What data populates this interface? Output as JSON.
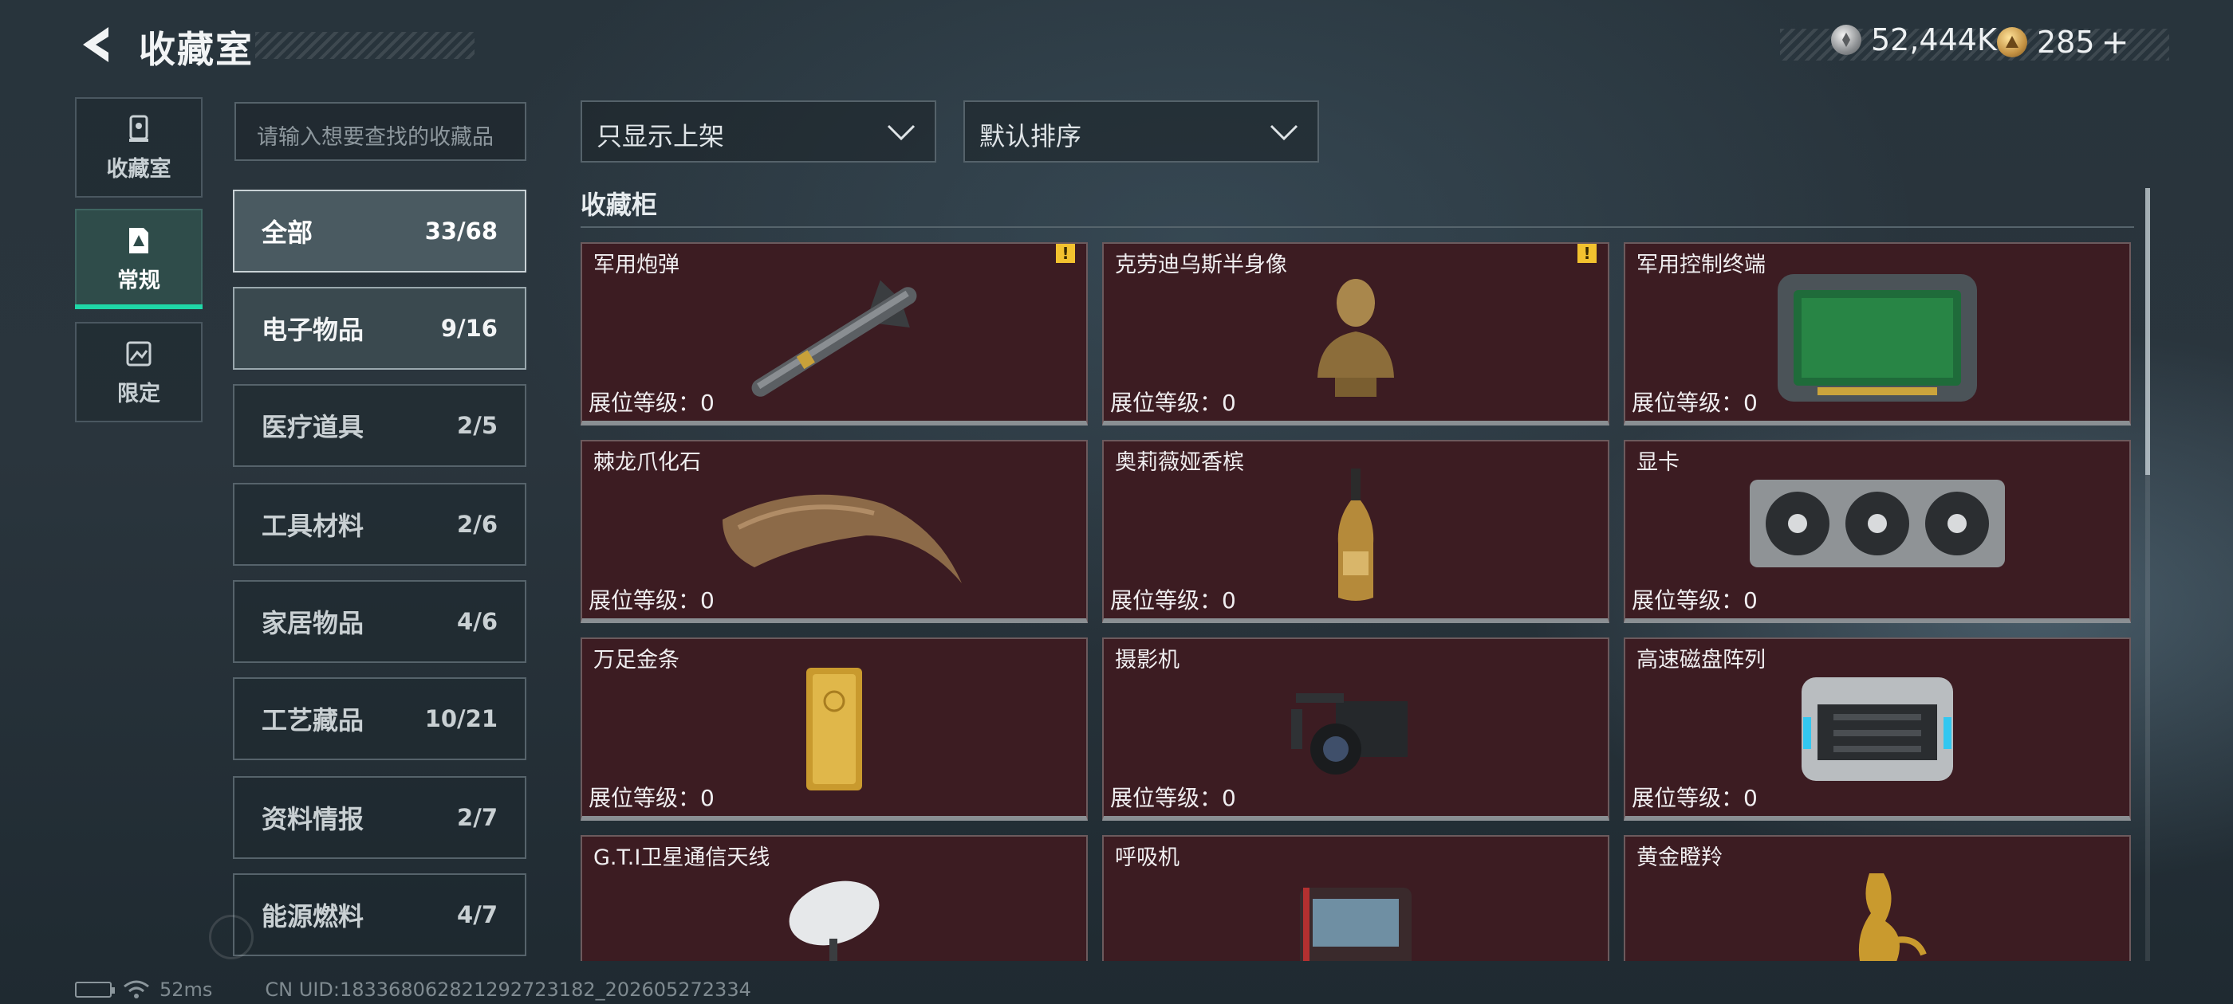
{
  "header": {
    "title": "收藏室",
    "currency_silver": "52,444K",
    "currency_gold": "285",
    "add_label": "+"
  },
  "nav": [
    {
      "label": "收藏室",
      "icon": "trophy-icon"
    },
    {
      "label": "常规",
      "icon": "card-icon",
      "active": true
    },
    {
      "label": "限定",
      "icon": "photo-icon"
    }
  ],
  "search": {
    "placeholder": "请输入想要查找的收藏品"
  },
  "filters": {
    "listing": "只显示上架",
    "sort": "默认排序"
  },
  "categories": [
    {
      "name": "全部",
      "count": "33/68"
    },
    {
      "name": "电子物品",
      "count": "9/16"
    },
    {
      "name": "医疗道具",
      "count": "2/5"
    },
    {
      "name": "工具材料",
      "count": "2/6"
    },
    {
      "name": "家居物品",
      "count": "4/6"
    },
    {
      "name": "工艺藏品",
      "count": "10/21"
    },
    {
      "name": "资料情报",
      "count": "2/7"
    },
    {
      "name": "能源燃料",
      "count": "4/7"
    }
  ],
  "section": {
    "title": "收藏柜"
  },
  "level_prefix": "展位等级：",
  "items": [
    {
      "name": "军用炮弹",
      "level": "展位等级：0",
      "warn": "!"
    },
    {
      "name": "克劳迪乌斯半身像",
      "level": "展位等级：0",
      "warn": "!"
    },
    {
      "name": "军用控制终端",
      "level": "展位等级：0"
    },
    {
      "name": "棘龙爪化石",
      "level": "展位等级：0"
    },
    {
      "name": "奥莉薇娅香槟",
      "level": "展位等级：0"
    },
    {
      "name": "显卡",
      "level": "展位等级：0"
    },
    {
      "name": "万足金条",
      "level": "展位等级：0"
    },
    {
      "name": "摄影机",
      "level": "展位等级：0"
    },
    {
      "name": "高速磁盘阵列",
      "level": "展位等级：0"
    },
    {
      "name": "G.T.I卫星通信天线",
      "level": ""
    },
    {
      "name": "呼吸机",
      "level": ""
    },
    {
      "name": "黄金瞪羚",
      "level": ""
    }
  ],
  "footer": {
    "latency": "52ms",
    "uid": "CN UID:183368062821292723182_202605272334"
  },
  "colors": {
    "accent": "#1fd7a7",
    "card_bg": "#3c1c22",
    "warn": "#f3c22f"
  }
}
